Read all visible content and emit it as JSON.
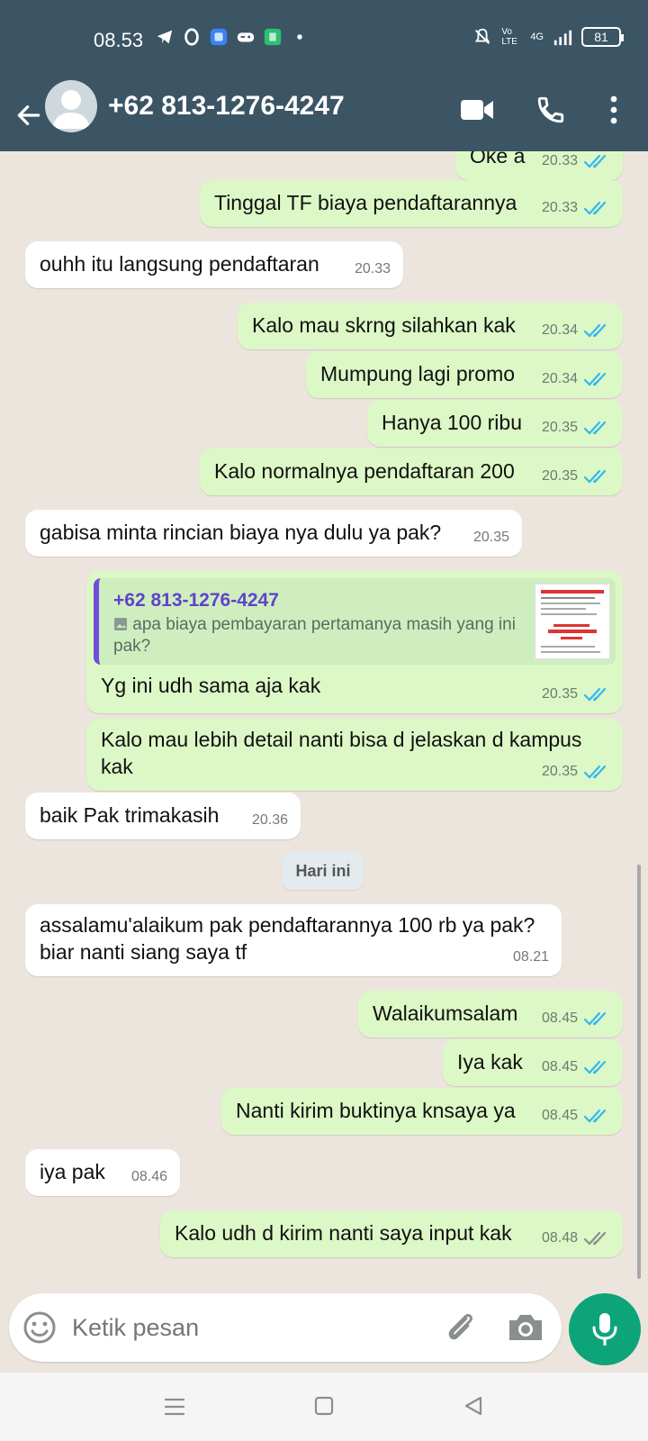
{
  "status_bar": {
    "time": "08.53",
    "battery": "81",
    "network": "4G",
    "volte": "Vo LTE"
  },
  "header": {
    "contact": "+62 813-1276-4247"
  },
  "messages": [
    {
      "dir": "out",
      "text": "Oke a",
      "time": "20.33",
      "read": true
    },
    {
      "dir": "out",
      "text": "Tinggal TF biaya pendaftarannya",
      "time": "20.33",
      "read": true
    },
    {
      "dir": "in",
      "text": "ouhh itu langsung pendaftaran",
      "time": "20.33"
    },
    {
      "dir": "out",
      "text": "Kalo mau skrng silahkan kak",
      "time": "20.34",
      "read": true
    },
    {
      "dir": "out",
      "text": "Mumpung lagi promo",
      "time": "20.34",
      "read": true
    },
    {
      "dir": "out",
      "text": "Hanya 100 ribu",
      "time": "20.35",
      "read": true
    },
    {
      "dir": "out",
      "text": "Kalo normalnya pendaftaran 200",
      "time": "20.35",
      "read": true
    },
    {
      "dir": "in",
      "text": "gabisa minta rincian biaya nya dulu ya pak?",
      "time": "20.35"
    },
    {
      "dir": "out",
      "quote_name": "+62 813-1276-4247",
      "quote_text": "apa biaya pembayaran pertamanya masih yang ini pak?",
      "text": "Yg ini udh sama aja kak",
      "time": "20.35",
      "read": true
    },
    {
      "dir": "out",
      "text": "Kalo mau lebih detail nanti bisa d jelaskan d kampus kak",
      "time": "20.35",
      "read": true
    },
    {
      "dir": "in",
      "text": "baik Pak trimakasih",
      "time": "20.36"
    },
    {
      "dir": "in",
      "text": "assalamu'alaikum pak pendaftarannya 100 rb ya pak?\nbiar nanti siang saya tf",
      "time": "08.21"
    },
    {
      "dir": "out",
      "text": "Walaikumsalam",
      "time": "08.45",
      "read": true
    },
    {
      "dir": "out",
      "text": "Iya kak",
      "time": "08.45",
      "read": true
    },
    {
      "dir": "out",
      "text": "Nanti kirim buktinya knsaya ya",
      "time": "08.45",
      "read": true
    },
    {
      "dir": "in",
      "text": "iya pak",
      "time": "08.46"
    },
    {
      "dir": "out",
      "text": "Kalo udh d kirim nanti saya input kak",
      "time": "08.48",
      "read": false
    }
  ],
  "day_label": "Hari ini",
  "input": {
    "placeholder": "Ketik pesan"
  },
  "colors": {
    "header": "#3b5564",
    "outgoing": "#dcf8c6",
    "incoming": "#ffffff",
    "chat_bg": "#ece5dd",
    "read_tick": "#34b7f1",
    "mic": "#0ea47a"
  }
}
